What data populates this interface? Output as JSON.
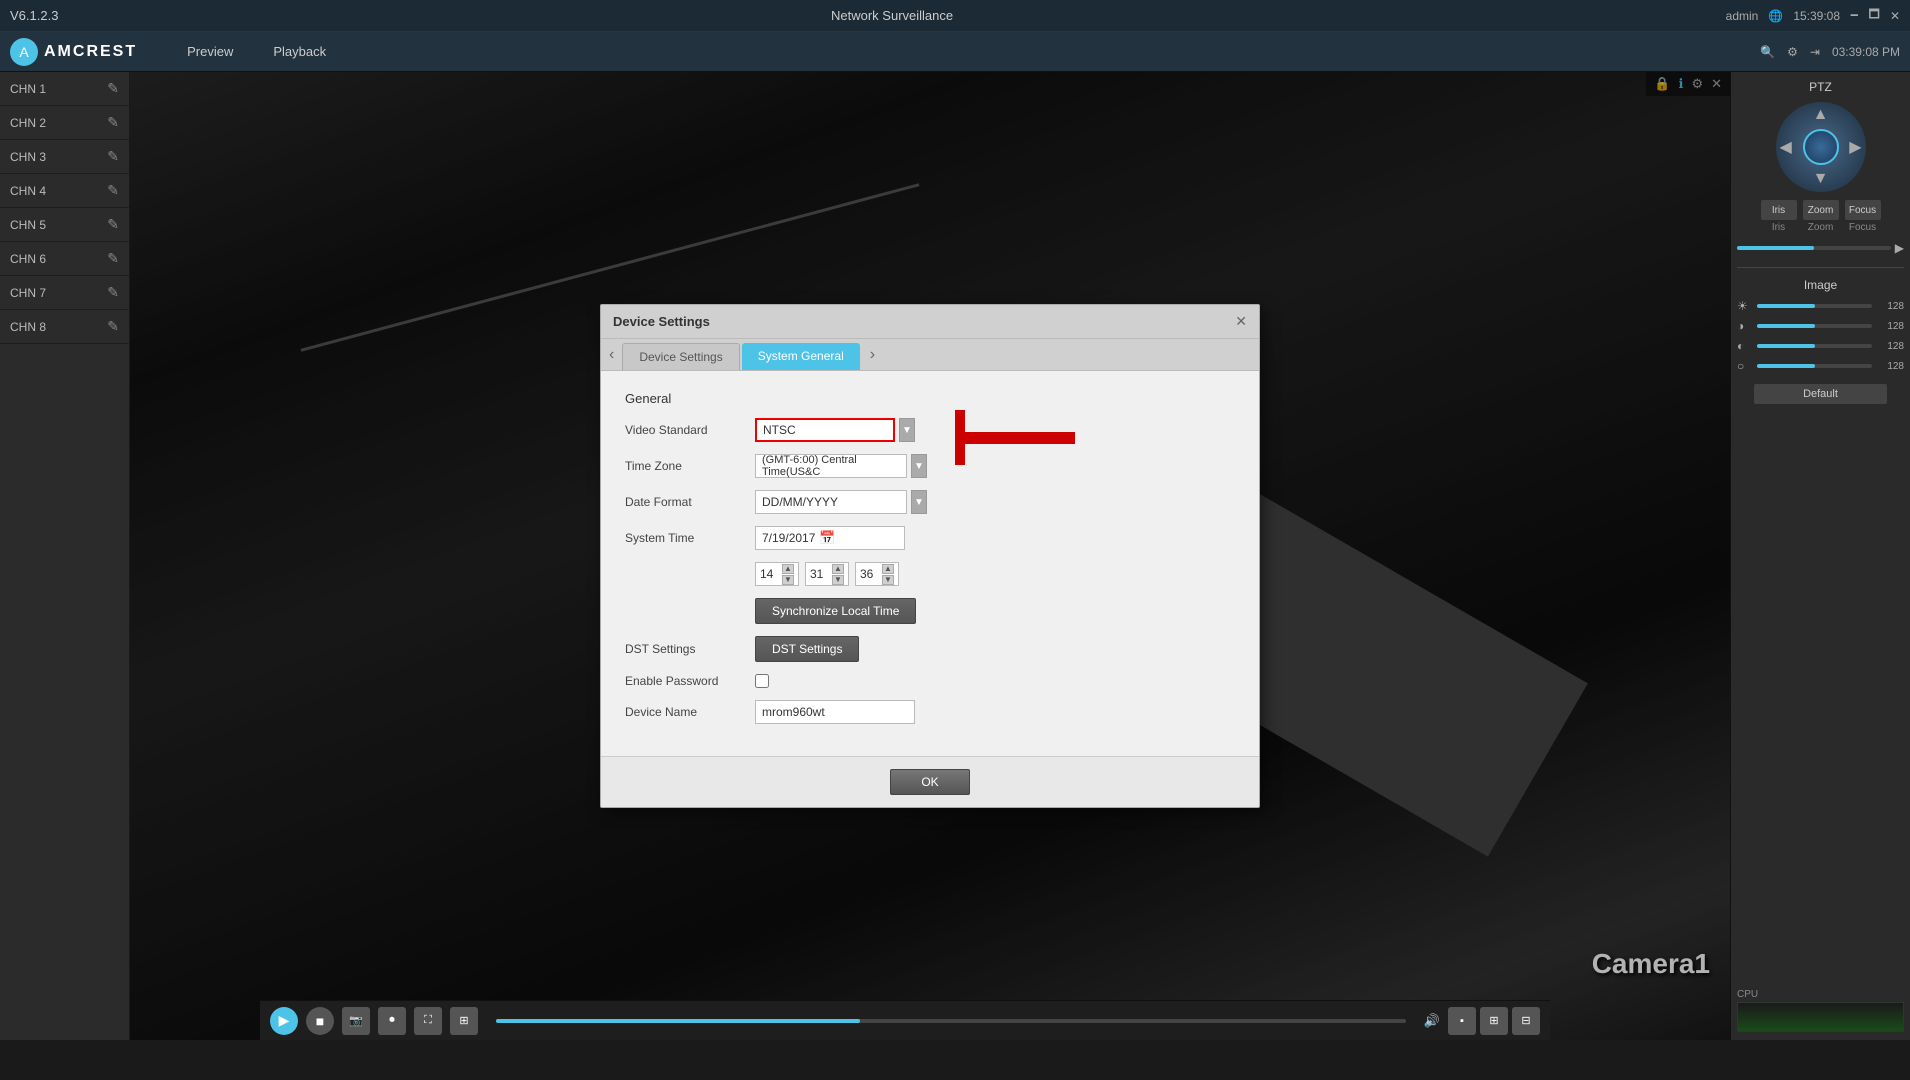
{
  "topbar": {
    "version": "V6.1.2.3",
    "title": "Network Surveillance",
    "admin": "admin",
    "time": "15:39:08",
    "date_time": "03:39:08 PM"
  },
  "navbar": {
    "logo": "AMCREST",
    "items": [
      "Preview",
      "Playback"
    ]
  },
  "sidebar": {
    "channels": [
      {
        "label": "CHN 1"
      },
      {
        "label": "CHN 2"
      },
      {
        "label": "CHN 3"
      },
      {
        "label": "CHN 4"
      },
      {
        "label": "CHN 5"
      },
      {
        "label": "CHN 6"
      },
      {
        "label": "CHN 7"
      },
      {
        "label": "CHN 8"
      }
    ]
  },
  "dialog": {
    "title": "Device Settings",
    "close_label": "✕",
    "tabs": [
      {
        "label": "Device Settings",
        "active": false
      },
      {
        "label": "System General",
        "active": true
      }
    ],
    "general_label": "General",
    "fields": {
      "video_standard": {
        "label": "Video Standard",
        "value": "NTSC"
      },
      "time_zone": {
        "label": "Time Zone",
        "value": "(GMT-6:00) Central Time(US&C"
      },
      "date_format": {
        "label": "Date Format",
        "value": "DD/MM/YYYY"
      },
      "system_time": {
        "label": "System Time",
        "date_value": "7/19/2017",
        "hour": "14",
        "minute": "31",
        "second": "36"
      },
      "sync_btn": "Synchronize Local Time",
      "dst_settings": {
        "label": "DST Settings",
        "btn_label": "DST Settings"
      },
      "enable_password": {
        "label": "Enable Password"
      },
      "device_name": {
        "label": "Device Name",
        "value": "mrom960wt"
      }
    },
    "ok_btn": "OK"
  },
  "right_panel": {
    "ptz_label": "PTZ",
    "controls": [
      "Iris",
      "Zoom",
      "Focus"
    ],
    "image_label": "Image",
    "sliders": [
      {
        "icon": "☀",
        "value": 128,
        "fill_pct": 50
      },
      {
        "icon": "◑",
        "value": 128,
        "fill_pct": 50
      },
      {
        "icon": "◐",
        "value": 128,
        "fill_pct": 50
      },
      {
        "icon": "○",
        "value": 128,
        "fill_pct": 50
      }
    ],
    "default_btn": "Default"
  },
  "camera_label": "Camera1",
  "bottom_controls": {
    "volume_icon": "🔊"
  }
}
